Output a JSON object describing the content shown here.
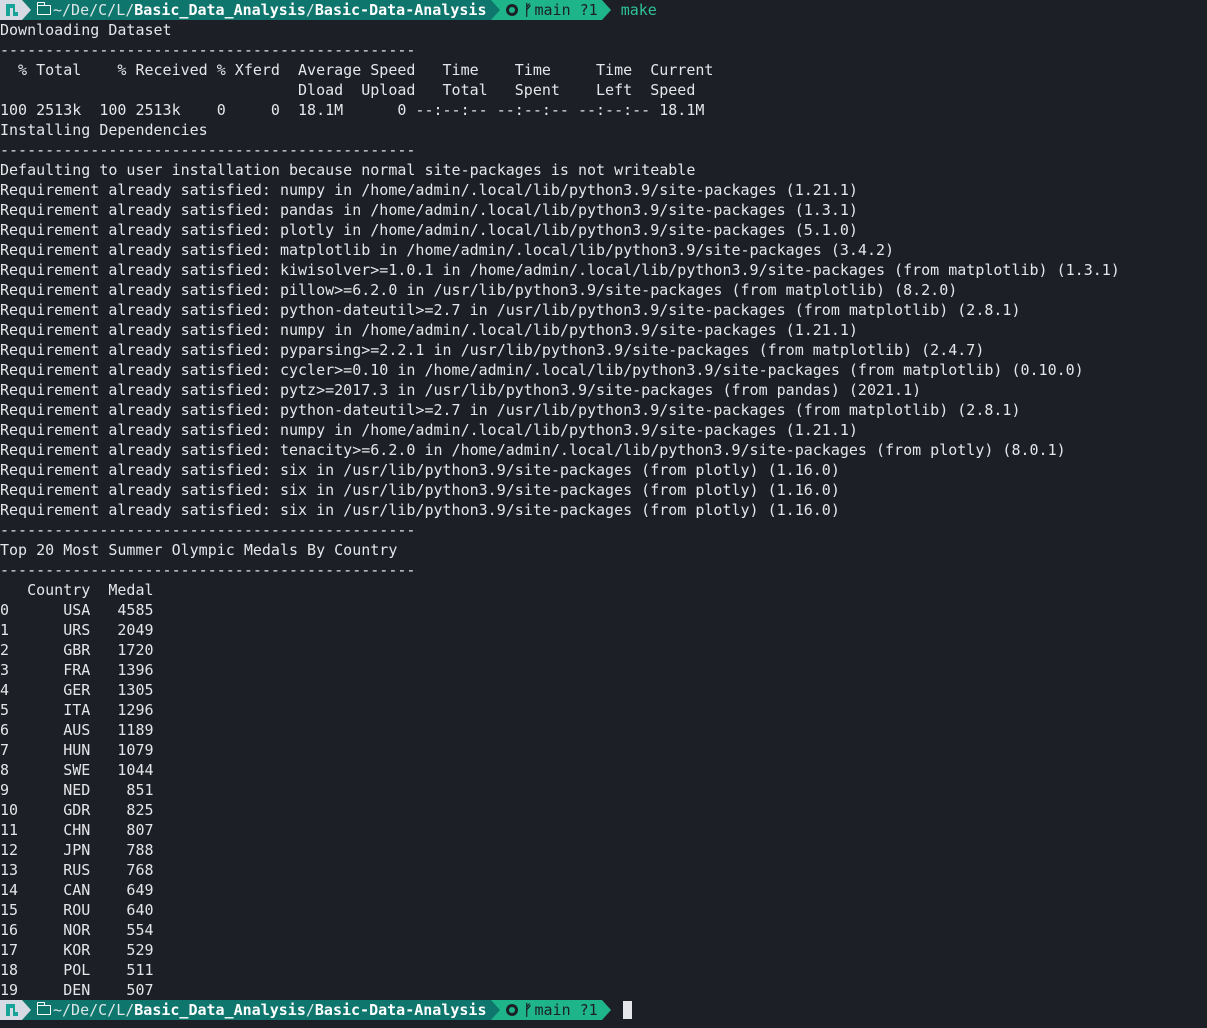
{
  "prompt": {
    "path_prefix": "~/De/C/L/",
    "path_dir1": "Basic_Data_Analysis",
    "path_sep": "/",
    "path_dir2": "Basic-Data-Analysis",
    "branch": "main ?1",
    "command": "make"
  },
  "output": {
    "download_heading": "Downloading Dataset",
    "separator": "----------------------------------------------",
    "curl_header1": "  % Total    % Received % Xferd  Average Speed   Time    Time     Time  Current",
    "curl_header2": "                                 Dload  Upload   Total   Spent    Left  Speed",
    "curl_progress": "100 2513k  100 2513k    0     0  18.1M      0 --:--:-- --:--:-- --:--:-- 18.1M",
    "install_heading": "Installing Dependencies",
    "install_lines": [
      "Defaulting to user installation because normal site-packages is not writeable",
      "Requirement already satisfied: numpy in /home/admin/.local/lib/python3.9/site-packages (1.21.1)",
      "Requirement already satisfied: pandas in /home/admin/.local/lib/python3.9/site-packages (1.3.1)",
      "Requirement already satisfied: plotly in /home/admin/.local/lib/python3.9/site-packages (5.1.0)",
      "Requirement already satisfied: matplotlib in /home/admin/.local/lib/python3.9/site-packages (3.4.2)",
      "Requirement already satisfied: kiwisolver>=1.0.1 in /home/admin/.local/lib/python3.9/site-packages (from matplotlib) (1.3.1)",
      "Requirement already satisfied: pillow>=6.2.0 in /usr/lib/python3.9/site-packages (from matplotlib) (8.2.0)",
      "Requirement already satisfied: python-dateutil>=2.7 in /usr/lib/python3.9/site-packages (from matplotlib) (2.8.1)",
      "Requirement already satisfied: numpy in /home/admin/.local/lib/python3.9/site-packages (1.21.1)",
      "Requirement already satisfied: pyparsing>=2.2.1 in /usr/lib/python3.9/site-packages (from matplotlib) (2.4.7)",
      "Requirement already satisfied: cycler>=0.10 in /home/admin/.local/lib/python3.9/site-packages (from matplotlib) (0.10.0)",
      "Requirement already satisfied: pytz>=2017.3 in /usr/lib/python3.9/site-packages (from pandas) (2021.1)",
      "Requirement already satisfied: python-dateutil>=2.7 in /usr/lib/python3.9/site-packages (from matplotlib) (2.8.1)",
      "Requirement already satisfied: numpy in /home/admin/.local/lib/python3.9/site-packages (1.21.1)",
      "Requirement already satisfied: tenacity>=6.2.0 in /home/admin/.local/lib/python3.9/site-packages (from plotly) (8.0.1)",
      "Requirement already satisfied: six in /usr/lib/python3.9/site-packages (from plotly) (1.16.0)",
      "Requirement already satisfied: six in /usr/lib/python3.9/site-packages (from plotly) (1.16.0)",
      "Requirement already satisfied: six in /usr/lib/python3.9/site-packages (from plotly) (1.16.0)"
    ],
    "medals_heading": "Top 20 Most Summer Olympic Medals By Country",
    "table_header": "   Country  Medal",
    "table_rows": [
      "0      USA   4585",
      "1      URS   2049",
      "2      GBR   1720",
      "3      FRA   1396",
      "4      GER   1305",
      "5      ITA   1296",
      "6      AUS   1189",
      "7      HUN   1079",
      "8      SWE   1044",
      "9      NED    851",
      "10     GDR    825",
      "11     CHN    807",
      "12     JPN    788",
      "13     RUS    768",
      "14     CAN    649",
      "15     ROU    640",
      "16     NOR    554",
      "17     KOR    529",
      "18     POL    511",
      "19     DEN    507"
    ]
  }
}
